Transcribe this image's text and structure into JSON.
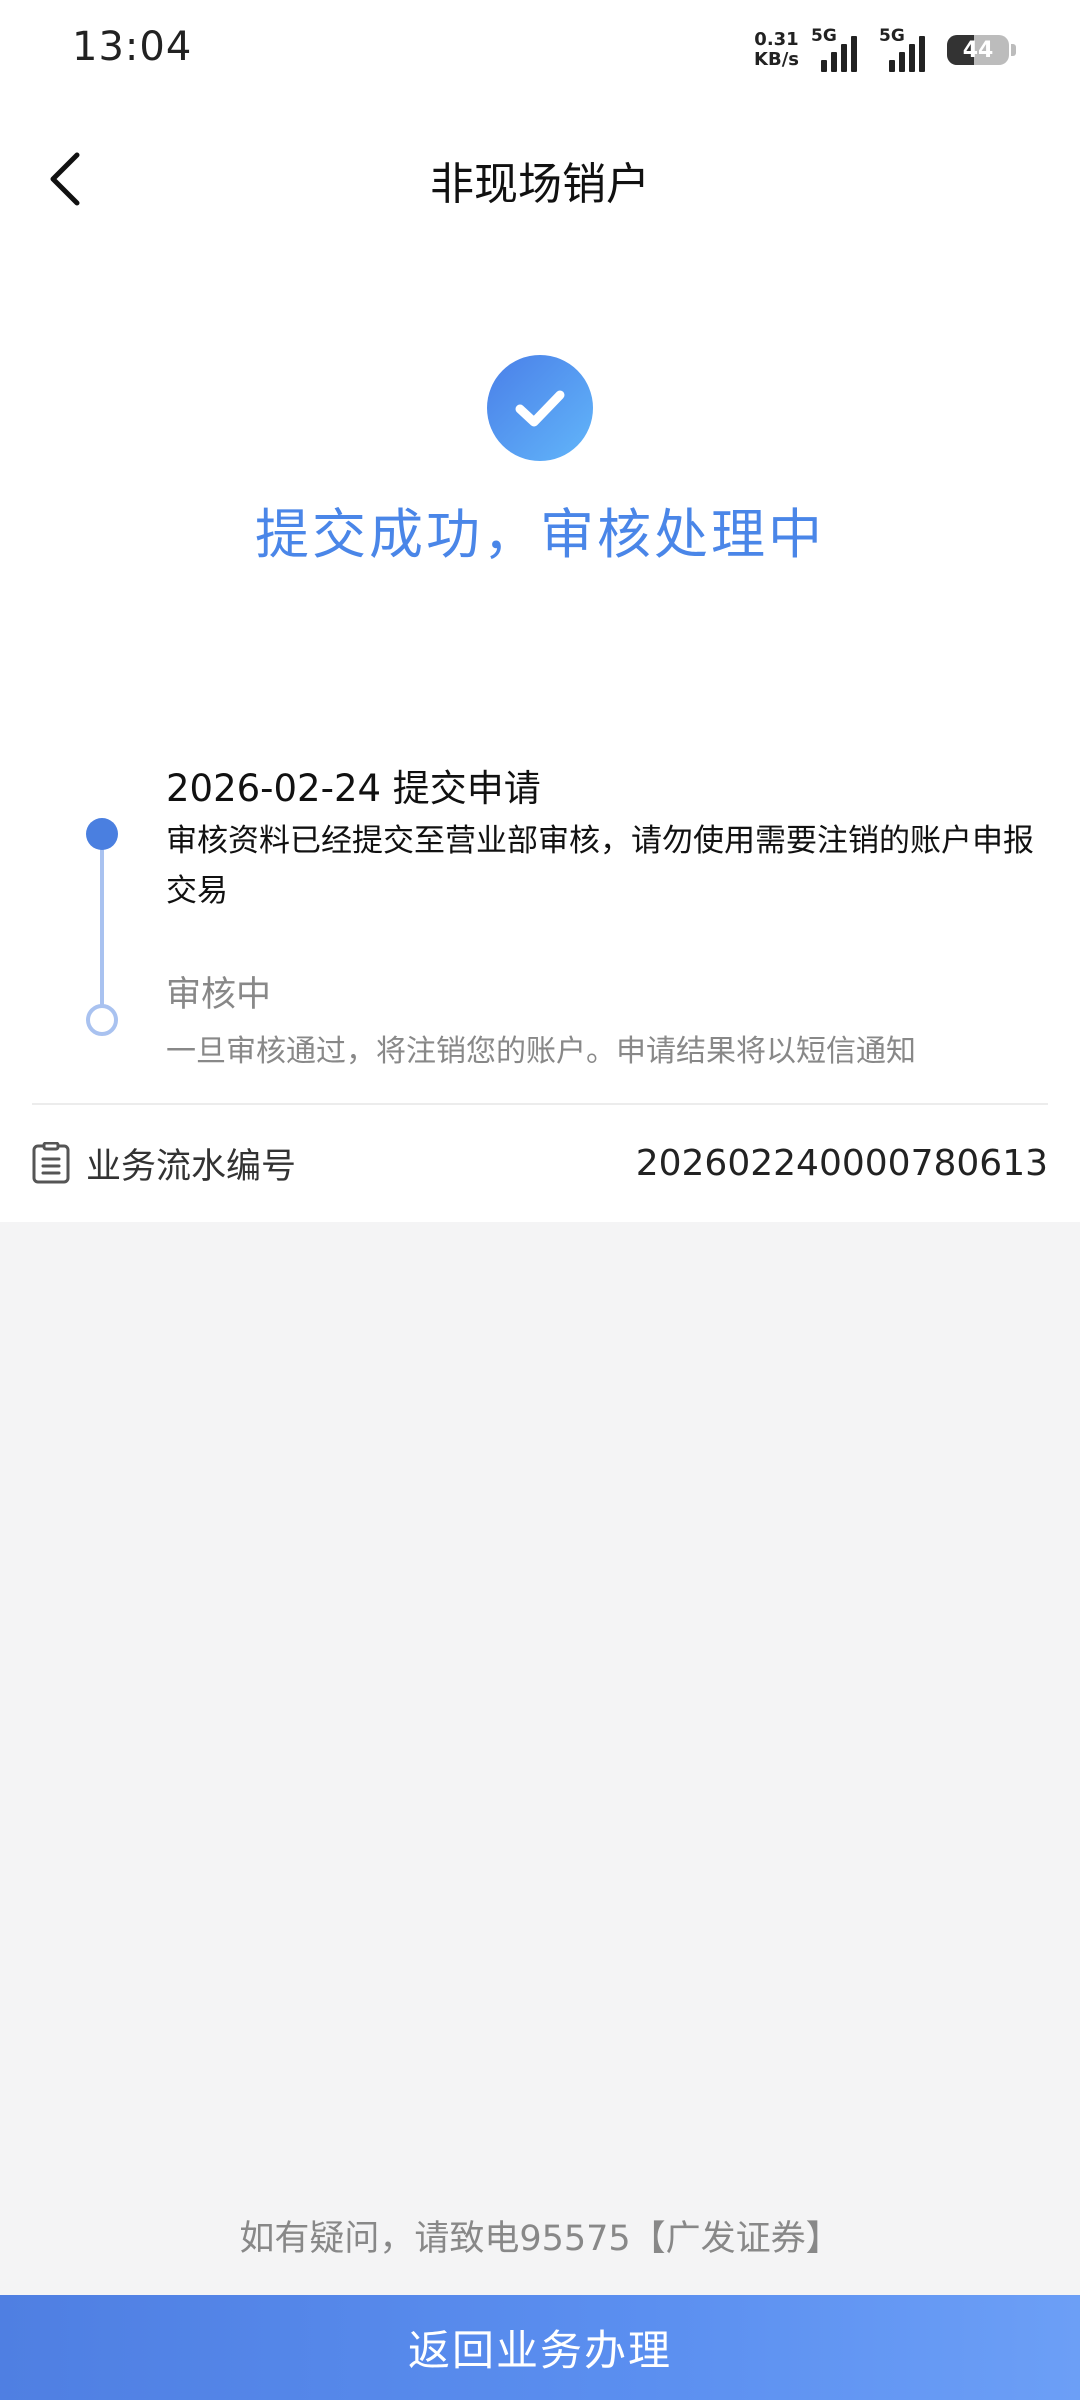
{
  "status_bar": {
    "time": "13:04",
    "net_speed_value": "0.31",
    "net_speed_unit": "KB/s",
    "signal1_label": "5G",
    "signal2_label": "5G",
    "battery": "44",
    "battery_level": 0.44
  },
  "nav": {
    "title": "非现场销户",
    "back_icon": "chevron-left-icon"
  },
  "result": {
    "icon": "check-circle-icon",
    "title": "提交成功，审核处理中",
    "accent_color": "#4a86e8"
  },
  "timeline": {
    "steps": [
      {
        "title": "2026-02-24 提交申请",
        "desc": "审核资料已经提交至营业部审核，请勿使用需要注销的账户申报交易",
        "state": "done"
      },
      {
        "title": "审核中",
        "desc": "一旦审核通过，将注销您的账户。申请结果将以短信通知",
        "state": "pending"
      }
    ]
  },
  "serial": {
    "icon": "document-icon",
    "label": "业务流水编号",
    "value": "20260224000078061З"
  },
  "footer": {
    "hotline": "如有疑问，请致电95575【广发证券】",
    "button_label": "返回业务办理"
  }
}
